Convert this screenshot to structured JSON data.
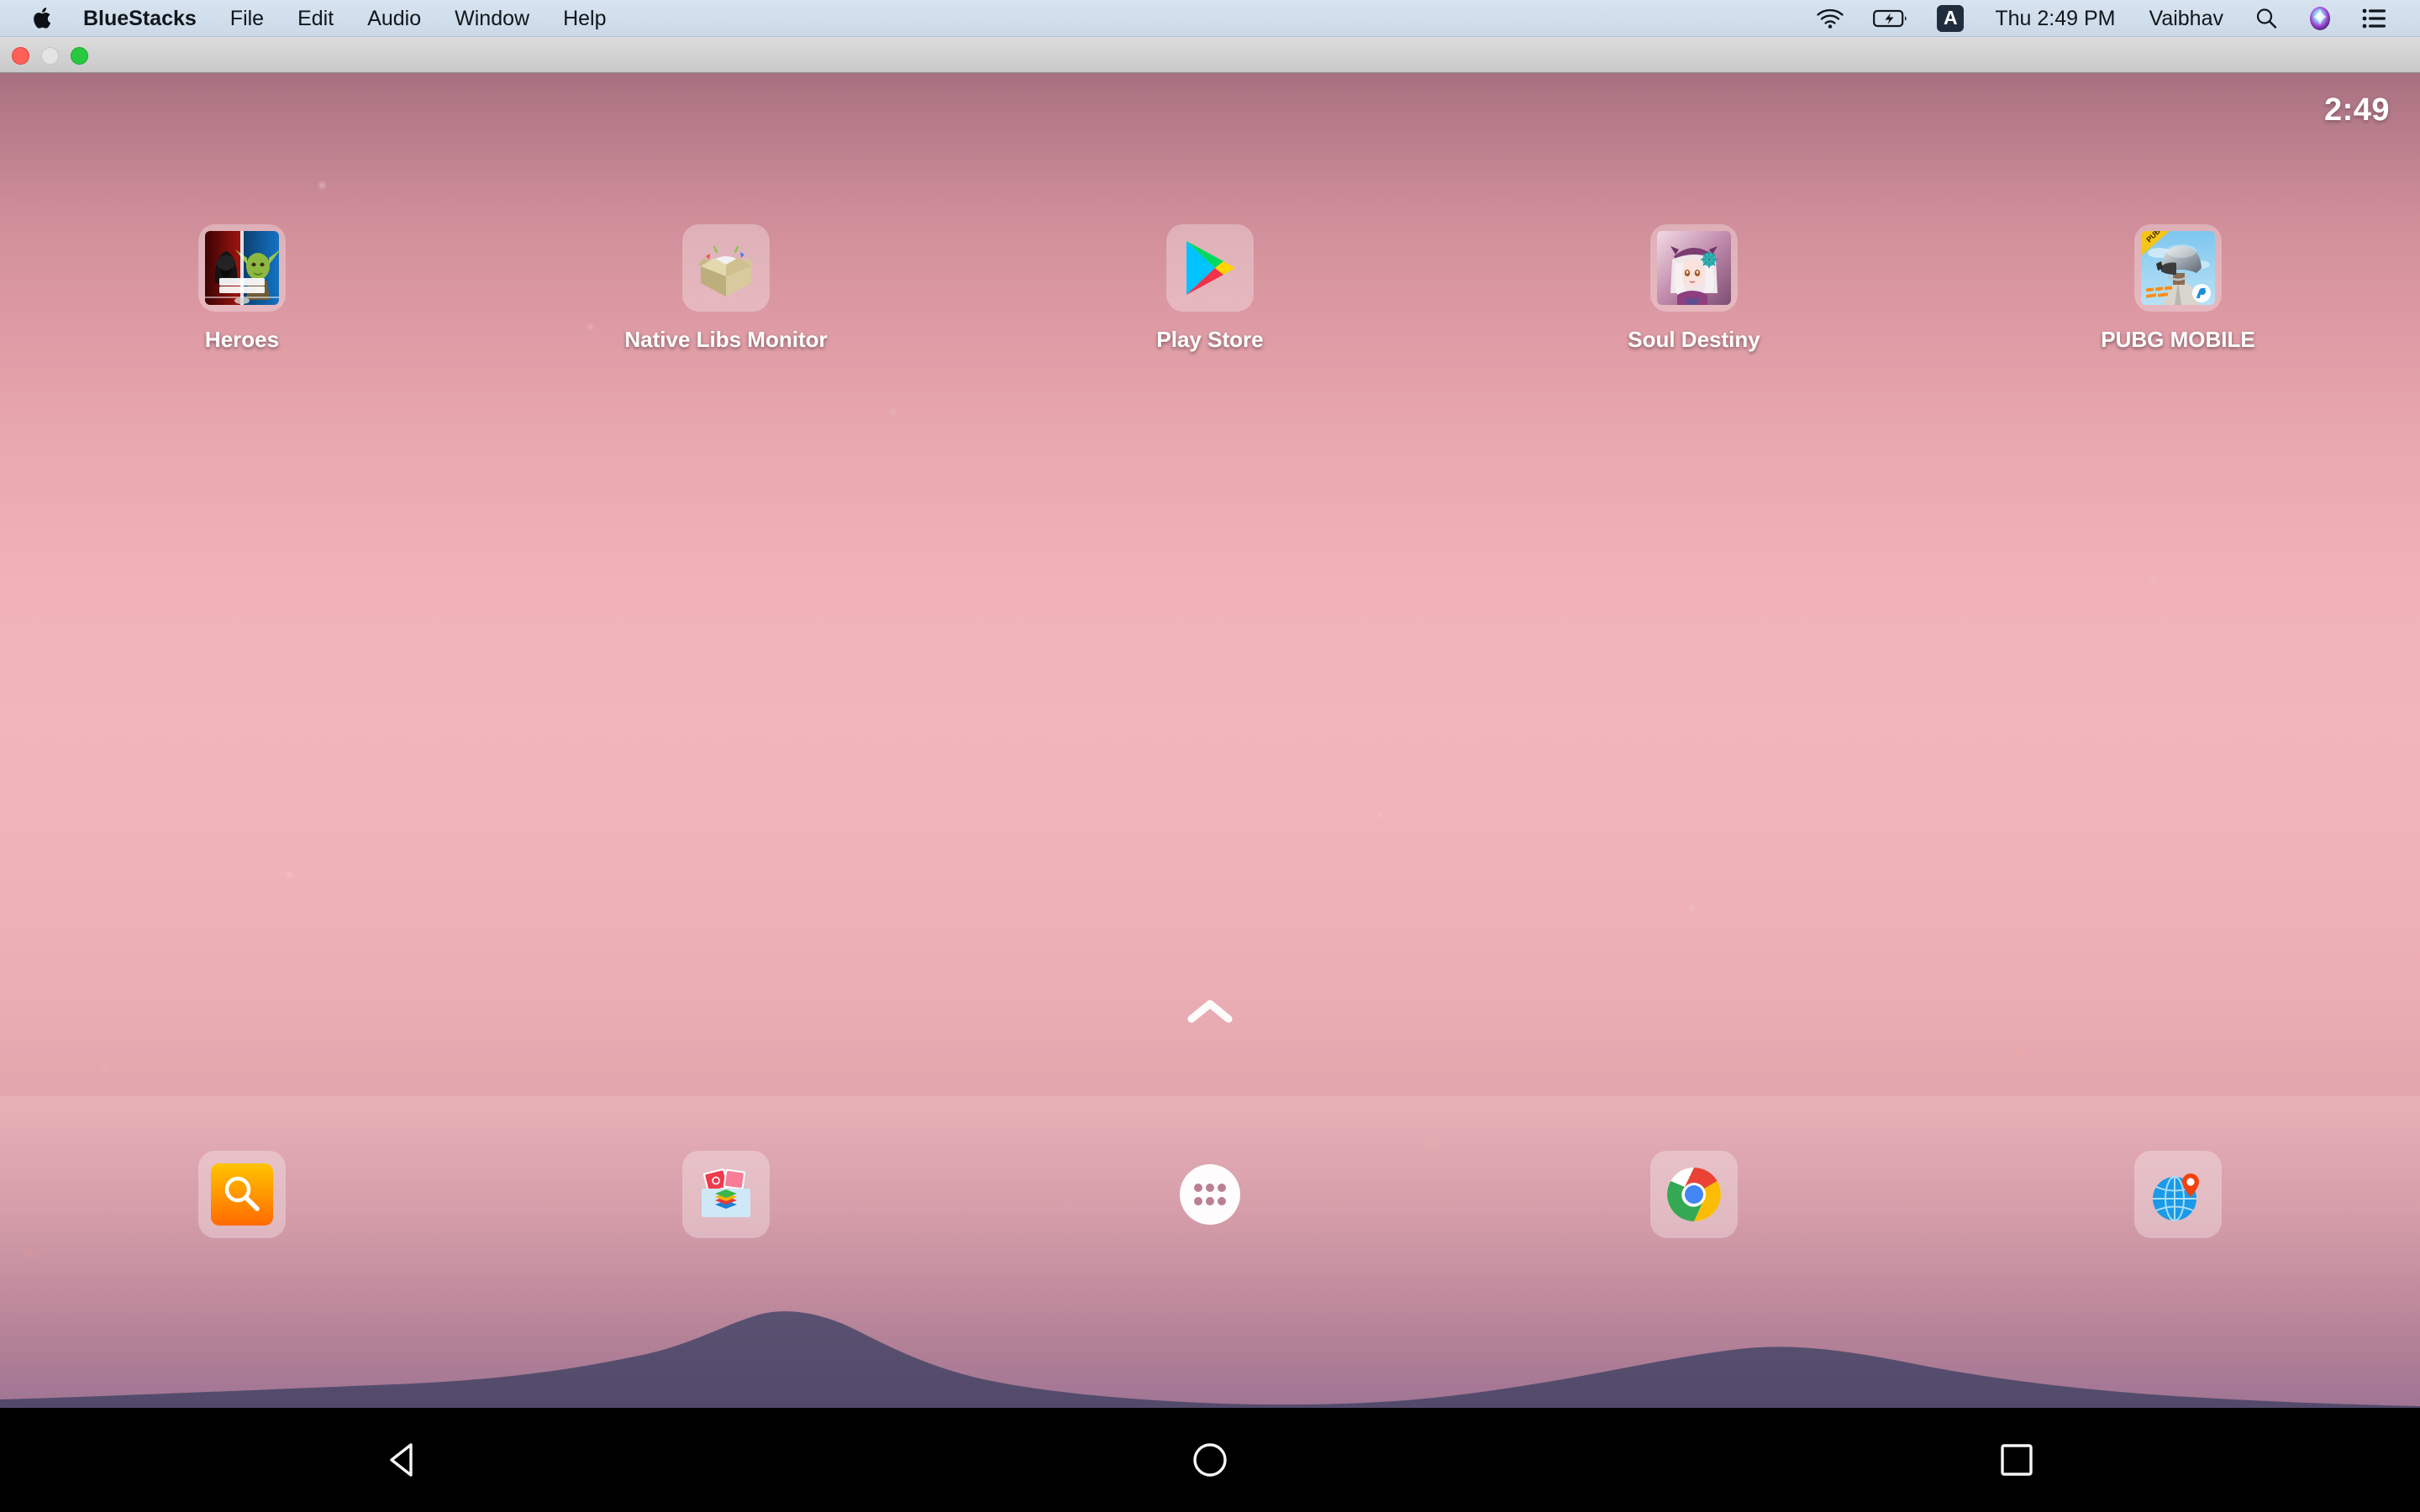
{
  "menubar": {
    "apple_icon": "apple-logo",
    "items": [
      {
        "label": "BlueStacks",
        "bold": true
      },
      {
        "label": "File",
        "bold": false
      },
      {
        "label": "Edit",
        "bold": false
      },
      {
        "label": "Audio",
        "bold": false
      },
      {
        "label": "Window",
        "bold": false
      },
      {
        "label": "Help",
        "bold": false
      }
    ],
    "status": {
      "wifi_icon": "wifi-icon",
      "battery_icon": "battery-charging-icon",
      "input_source": "A",
      "datetime": "Thu 2:49 PM",
      "user": "Vaibhav",
      "search_icon": "search-icon",
      "siri_icon": "siri-icon",
      "control_center_icon": "control-center-icon"
    }
  },
  "window": {
    "close_label": "Close",
    "minimize_label": "Minimize",
    "zoom_label": "Zoom"
  },
  "android": {
    "status_clock": "2:49",
    "apps": [
      {
        "name": "Heroes",
        "icon": "star-wars-heroes-icon"
      },
      {
        "name": "Native Libs Monitor",
        "icon": "native-libs-monitor-icon"
      },
      {
        "name": "Play Store",
        "icon": "play-store-icon"
      },
      {
        "name": "Soul Destiny",
        "icon": "soul-destiny-icon"
      },
      {
        "name": "PUBG MOBILE",
        "icon": "pubg-mobile-icon"
      }
    ],
    "drawer_handle_icon": "chevron-up-icon",
    "dock": [
      {
        "name": "Search",
        "icon": "search-app-icon"
      },
      {
        "name": "Media",
        "icon": "media-manager-icon"
      },
      {
        "name": "App Drawer",
        "icon": "app-drawer-icon"
      },
      {
        "name": "Chrome",
        "icon": "chrome-icon"
      },
      {
        "name": "Browser",
        "icon": "globe-pin-icon"
      }
    ],
    "navbar": [
      {
        "name": "Back",
        "icon": "back-triangle-icon"
      },
      {
        "name": "Home",
        "icon": "home-circle-icon"
      },
      {
        "name": "Recents",
        "icon": "recents-square-icon"
      }
    ]
  },
  "colors": {
    "wallpaper_top": "#a8707f",
    "wallpaper_mid": "#f1b5ba",
    "wallpaper_bottom": "#8a6b90",
    "mountain": "#534a6b",
    "navbar_bg": "#000000",
    "menubar_bg": "#cbd9e8",
    "accent_search": "#f98b0a"
  }
}
